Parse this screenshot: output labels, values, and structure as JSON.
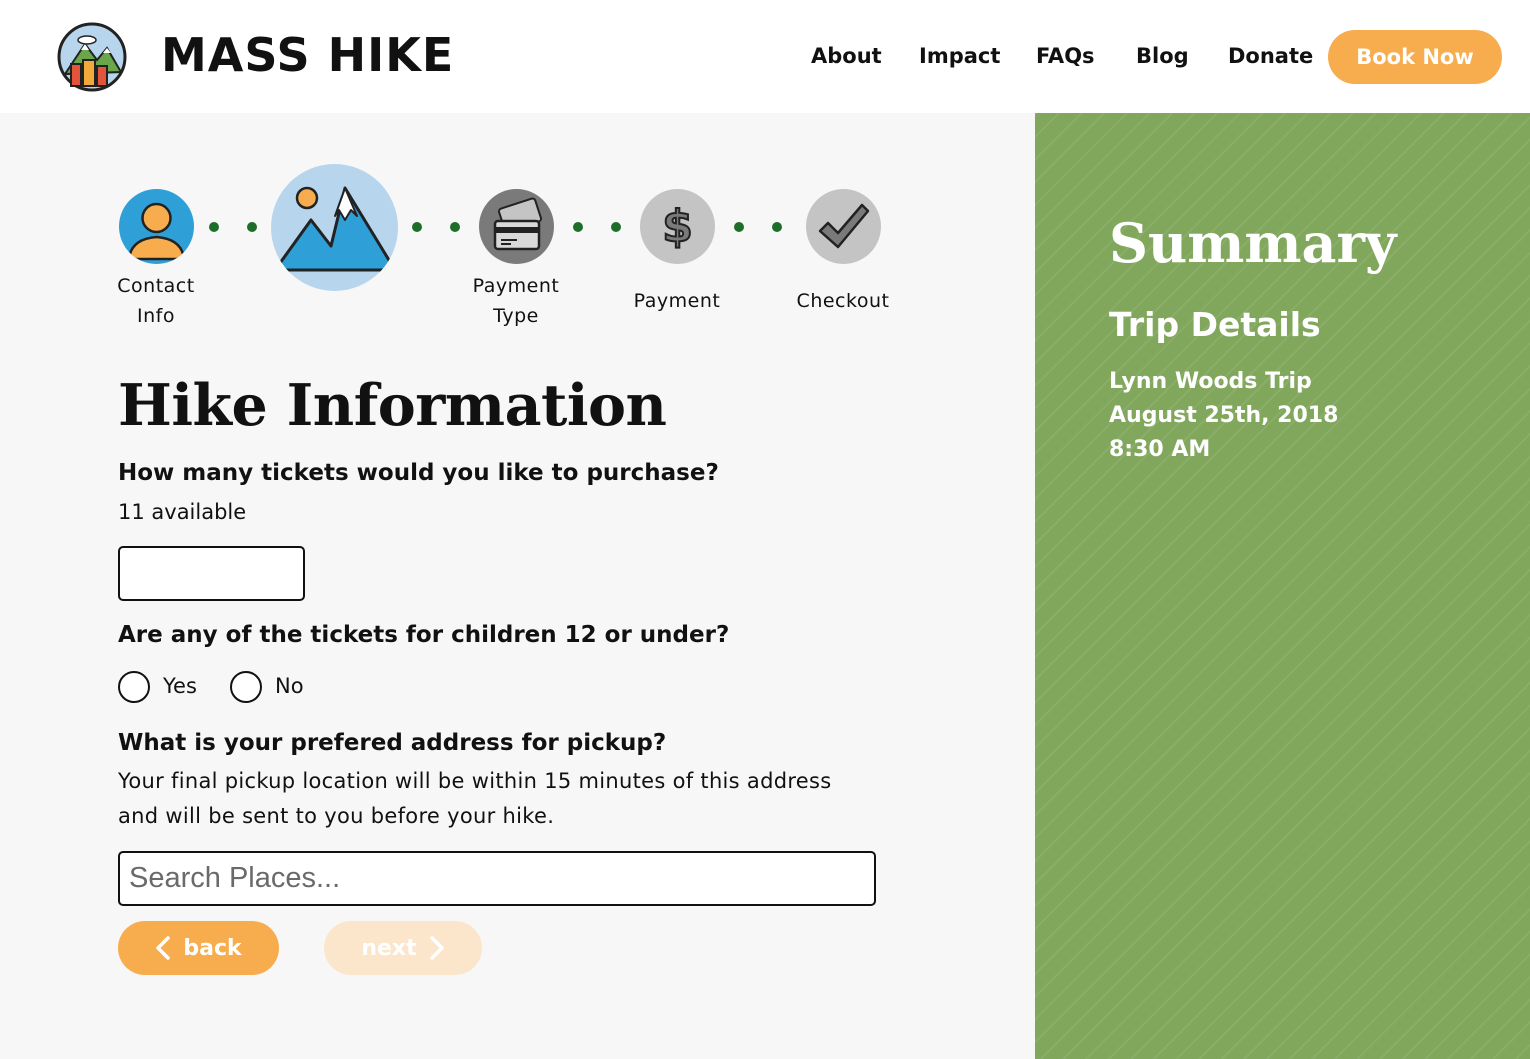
{
  "header": {
    "brand": "MASS HIKE",
    "nav": [
      "About",
      "Impact",
      "FAQs",
      "Blog",
      "Donate"
    ],
    "cta": "Book Now"
  },
  "steps": [
    {
      "label_line1": "Contact",
      "label_line2": "Info",
      "icon": "person-icon",
      "state": "complete"
    },
    {
      "label_line1": "",
      "label_line2": "",
      "icon": "mountain-icon",
      "state": "current"
    },
    {
      "label_line1": "Payment",
      "label_line2": "Type",
      "icon": "credit-card-icon",
      "state": "upcoming"
    },
    {
      "label_line1": "Payment",
      "label_line2": "",
      "icon": "dollar-icon",
      "state": "upcoming"
    },
    {
      "label_line1": "Checkout",
      "label_line2": "",
      "icon": "checkmark-icon",
      "state": "upcoming"
    }
  ],
  "form": {
    "title": "Hike Information",
    "q_tickets": "How many tickets would you like to purchase?",
    "tickets_available": "11 available",
    "tickets_value": "",
    "q_children": "Are any of the tickets for children 12 or under?",
    "yes_label": "Yes",
    "no_label": "No",
    "q_address": "What is your prefered address for pickup?",
    "address_help_1": "Your final pickup location will be within 15 minutes of this address",
    "address_help_2": "and will be sent to you before your hike.",
    "search_placeholder": "Search Places...",
    "back_label": "back",
    "next_label": "next"
  },
  "summary": {
    "title": "Summary",
    "trip_heading": "Trip Details",
    "trip_name": "Lynn Woods Trip",
    "trip_date": "August 25th, 2018",
    "trip_time": "8:30 AM"
  },
  "colors": {
    "accent_orange": "#f7ad4e",
    "summary_green": "#81a75d",
    "step_dot_green": "#1e6e2a",
    "step_active_blue": "#b7d6ee",
    "step_inactive_gray": "#c4c4c4"
  }
}
